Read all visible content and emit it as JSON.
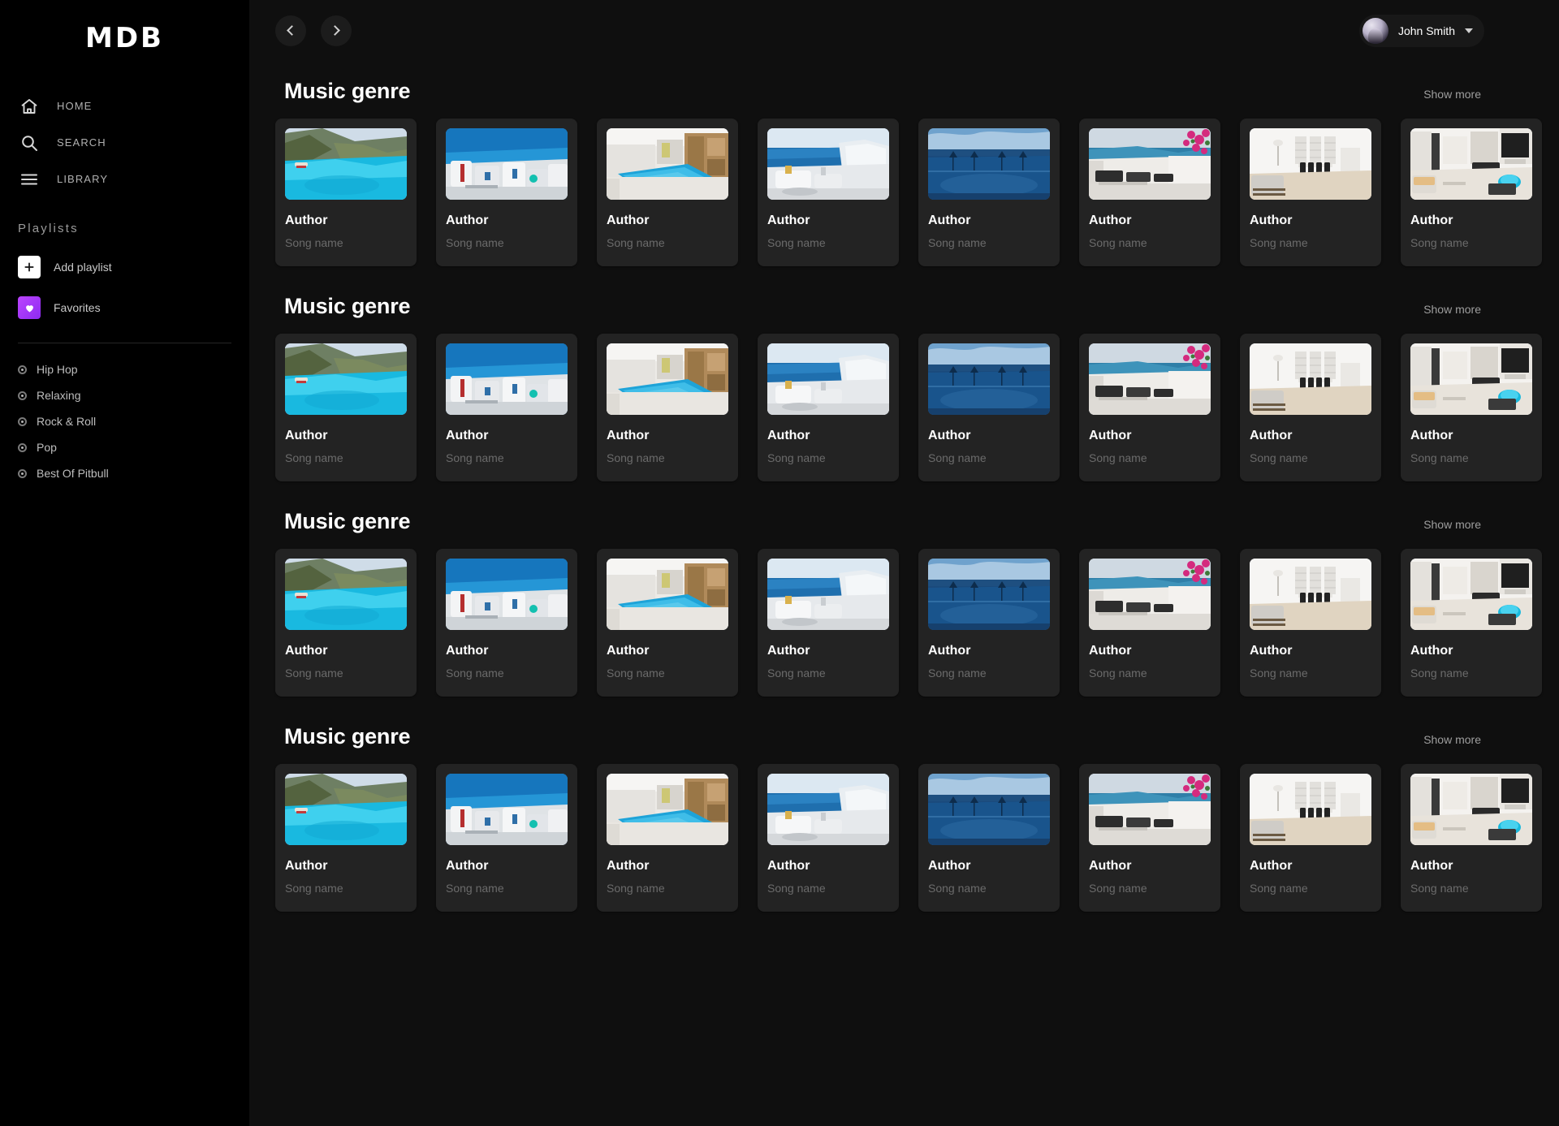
{
  "brand": {
    "logo": "MDB"
  },
  "sidebar": {
    "nav": [
      {
        "label": "HOME",
        "icon": "home-icon"
      },
      {
        "label": "SEARCH",
        "icon": "search-icon"
      },
      {
        "label": "LIBRARY",
        "icon": "library-icon"
      }
    ],
    "playlists_heading": "Playlists",
    "playlist_actions": [
      {
        "label": "Add playlist",
        "icon": "plus-icon"
      },
      {
        "label": "Favorites",
        "icon": "heart-icon"
      }
    ],
    "genres": [
      {
        "label": "Hip Hop"
      },
      {
        "label": "Relaxing"
      },
      {
        "label": "Rock & Roll"
      },
      {
        "label": "Pop"
      },
      {
        "label": "Best Of Pitbull"
      }
    ]
  },
  "topbar": {
    "back_icon": "chevron-left-icon",
    "forward_icon": "chevron-right-icon",
    "user": {
      "name": "John Smith",
      "caret_icon": "chevron-down-icon"
    }
  },
  "sections": [
    {
      "title": "Music genre",
      "show_more": "Show more",
      "cards": [
        {
          "author": "Author",
          "song": "Song name",
          "image": "coastal-cliff-turquoise-bay"
        },
        {
          "author": "Author",
          "song": "Song name",
          "image": "santorini-white-village"
        },
        {
          "author": "Author",
          "song": "Song name",
          "image": "indoor-swimming-pool"
        },
        {
          "author": "Author",
          "song": "Song name",
          "image": "santorini-terrace-sea"
        },
        {
          "author": "Author",
          "song": "Song name",
          "image": "infinity-pool-umbrellas"
        },
        {
          "author": "Author",
          "song": "Song name",
          "image": "seaside-terrace-bougainvillea"
        },
        {
          "author": "Author",
          "song": "Song name",
          "image": "white-dining-room"
        },
        {
          "author": "Author",
          "song": "Song name",
          "image": "modern-living-room"
        }
      ]
    },
    {
      "title": "Music genre",
      "show_more": "Show more",
      "cards": [
        {
          "author": "Author",
          "song": "Song name",
          "image": "coastal-cliff-turquoise-bay"
        },
        {
          "author": "Author",
          "song": "Song name",
          "image": "santorini-white-village"
        },
        {
          "author": "Author",
          "song": "Song name",
          "image": "indoor-swimming-pool"
        },
        {
          "author": "Author",
          "song": "Song name",
          "image": "santorini-terrace-sea"
        },
        {
          "author": "Author",
          "song": "Song name",
          "image": "infinity-pool-umbrellas"
        },
        {
          "author": "Author",
          "song": "Song name",
          "image": "seaside-terrace-bougainvillea"
        },
        {
          "author": "Author",
          "song": "Song name",
          "image": "white-dining-room"
        },
        {
          "author": "Author",
          "song": "Song name",
          "image": "modern-living-room"
        }
      ]
    },
    {
      "title": "Music genre",
      "show_more": "Show more",
      "cards": [
        {
          "author": "Author",
          "song": "Song name",
          "image": "coastal-cliff-turquoise-bay"
        },
        {
          "author": "Author",
          "song": "Song name",
          "image": "santorini-white-village"
        },
        {
          "author": "Author",
          "song": "Song name",
          "image": "indoor-swimming-pool"
        },
        {
          "author": "Author",
          "song": "Song name",
          "image": "santorini-terrace-sea"
        },
        {
          "author": "Author",
          "song": "Song name",
          "image": "infinity-pool-umbrellas"
        },
        {
          "author": "Author",
          "song": "Song name",
          "image": "seaside-terrace-bougainvillea"
        },
        {
          "author": "Author",
          "song": "Song name",
          "image": "white-dining-room"
        },
        {
          "author": "Author",
          "song": "Song name",
          "image": "modern-living-room"
        }
      ]
    },
    {
      "title": "Music genre",
      "show_more": "Show more",
      "cards": [
        {
          "author": "Author",
          "song": "Song name",
          "image": "coastal-cliff-turquoise-bay"
        },
        {
          "author": "Author",
          "song": "Song name",
          "image": "santorini-white-village"
        },
        {
          "author": "Author",
          "song": "Song name",
          "image": "indoor-swimming-pool"
        },
        {
          "author": "Author",
          "song": "Song name",
          "image": "santorini-terrace-sea"
        },
        {
          "author": "Author",
          "song": "Song name",
          "image": "infinity-pool-umbrellas"
        },
        {
          "author": "Author",
          "song": "Song name",
          "image": "seaside-terrace-bougainvillea"
        },
        {
          "author": "Author",
          "song": "Song name",
          "image": "white-dining-room"
        },
        {
          "author": "Author",
          "song": "Song name",
          "image": "modern-living-room"
        }
      ]
    }
  ],
  "colors": {
    "sidebar_bg": "#000000",
    "main_bg": "#0f0f0f",
    "card_bg": "#232323",
    "accent_purple": "#a22bf0",
    "text_primary": "#ffffff",
    "text_muted": "#6b6b6b"
  }
}
